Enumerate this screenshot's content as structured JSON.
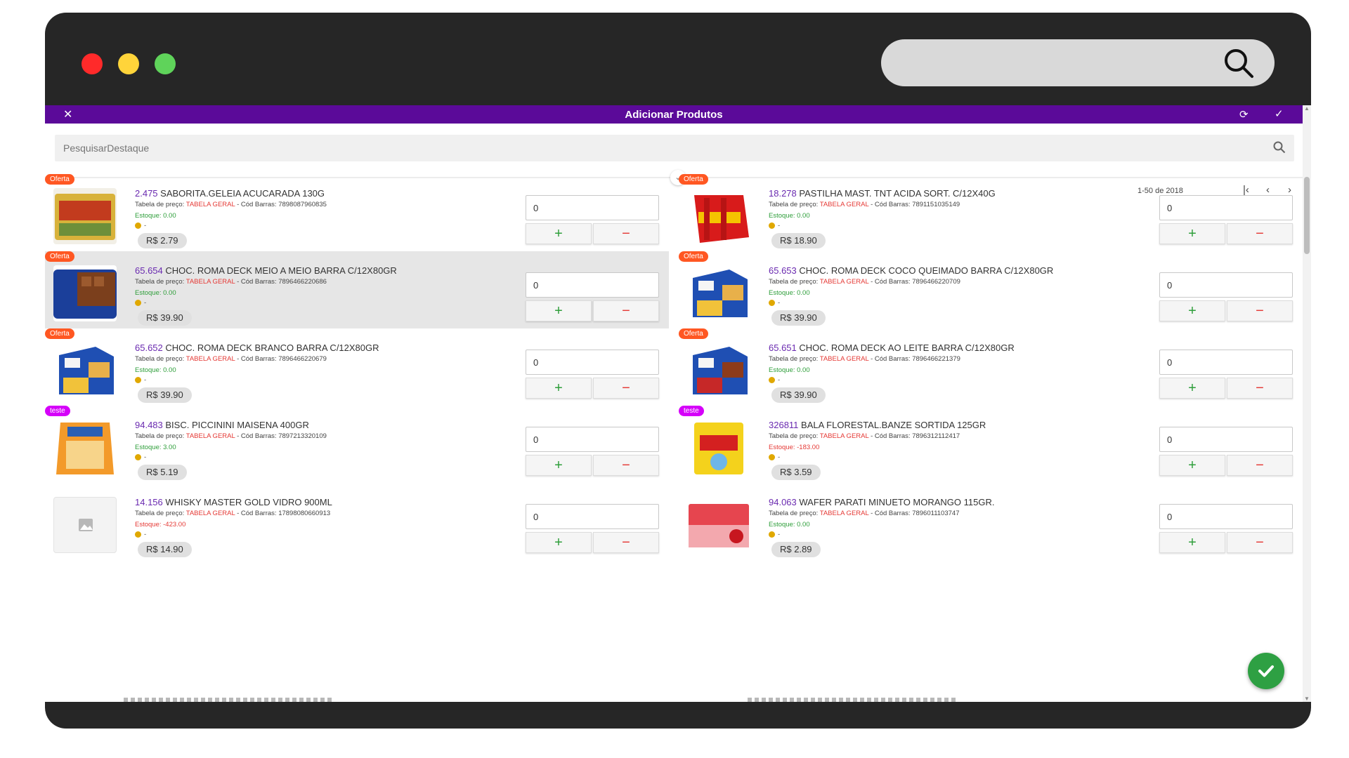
{
  "window": {
    "controls": [
      "close",
      "minimize",
      "maximize"
    ],
    "search_icon": "search-icon"
  },
  "topbar": {
    "title": "Adicionar Produtos",
    "close_glyph": "✕",
    "refresh_glyph": "⟳",
    "confirm_glyph": "✓"
  },
  "search": {
    "placeholder": "PesquisarDestaque"
  },
  "pager": {
    "range": "1-50 de 2018",
    "first": "|‹",
    "prev": "‹",
    "next": "›",
    "last": "›|"
  },
  "labels": {
    "price_table_prefix": "Tabela de preço:",
    "barcode_prefix": "- Cód Barras:",
    "coin_suffix": "-",
    "plus": "+",
    "minus": "−"
  },
  "colors": {
    "accent": "#5b0a99",
    "offer_badge": "#ff5722",
    "test_badge": "#d500f9",
    "stock_ok": "#2e9e3a",
    "stock_neg": "#e53935"
  },
  "products": [
    {
      "badge": "Oferta",
      "badge_type": "offer",
      "code": "2.475",
      "name": "SABORITA.GELEIA ACUCARADA 130G",
      "table": "TABELA GERAL",
      "barcode": "7898087960835",
      "stock": "Estoque: 0.00",
      "stock_status": "ok",
      "price": "R$ 2.79",
      "qty": "0",
      "thumb": "geleia",
      "selected": false
    },
    {
      "badge": "Oferta",
      "badge_type": "offer",
      "code": "18.278",
      "name": "PASTILHA MAST. TNT ACIDA SORT. C/12X40G",
      "table": "TABELA GERAL",
      "barcode": "7891151035149",
      "stock": "Estoque: 0.00",
      "stock_status": "ok",
      "price": "R$ 18.90",
      "qty": "0",
      "thumb": "tnt",
      "selected": false
    },
    {
      "badge": "Oferta",
      "badge_type": "offer",
      "code": "65.654",
      "name": "CHOC. ROMA DECK MEIO A MEIO BARRA C/12X80GR",
      "table": "TABELA GERAL",
      "barcode": "7896466220686",
      "stock": "Estoque: 0.00",
      "stock_status": "ok",
      "price": "R$ 39.90",
      "qty": "0",
      "thumb": "deck-meio",
      "selected": true
    },
    {
      "badge": "Oferta",
      "badge_type": "offer",
      "code": "65.653",
      "name": "CHOC. ROMA DECK COCO QUEIMADO BARRA C/12X80GR",
      "table": "TABELA GERAL",
      "barcode": "7896466220709",
      "stock": "Estoque: 0.00",
      "stock_status": "ok",
      "price": "R$ 39.90",
      "qty": "0",
      "thumb": "deck-blue",
      "selected": false
    },
    {
      "badge": "Oferta",
      "badge_type": "offer",
      "code": "65.652",
      "name": "CHOC. ROMA DECK BRANCO BARRA C/12X80GR",
      "table": "TABELA GERAL",
      "barcode": "7896466220679",
      "stock": "Estoque: 0.00",
      "stock_status": "ok",
      "price": "R$ 39.90",
      "qty": "0",
      "thumb": "deck-blue",
      "selected": false
    },
    {
      "badge": "Oferta",
      "badge_type": "offer",
      "code": "65.651",
      "name": "CHOC. ROMA DECK AO LEITE BARRA C/12X80GR",
      "table": "TABELA GERAL",
      "barcode": "7896466221379",
      "stock": "Estoque: 0.00",
      "stock_status": "ok",
      "price": "R$ 39.90",
      "qty": "0",
      "thumb": "deck-red",
      "selected": false
    },
    {
      "badge": "teste",
      "badge_type": "test",
      "code": "94.483",
      "name": "BISC. PICCININI MAISENA 400GR",
      "table": "TABELA GERAL",
      "barcode": "7897213320109",
      "stock": "Estoque: 3.00",
      "stock_status": "ok",
      "price": "R$ 5.19",
      "qty": "0",
      "thumb": "maisena",
      "selected": false
    },
    {
      "badge": "teste",
      "badge_type": "test",
      "code": "326811",
      "name": "BALA FLORESTAL.BANZE SORTIDA 125GR",
      "table": "TABELA GERAL",
      "barcode": "7896312112417",
      "stock": "Estoque: -183.00",
      "stock_status": "neg",
      "price": "R$ 3.59",
      "qty": "0",
      "thumb": "banze",
      "selected": false
    },
    {
      "badge": "",
      "badge_type": "none",
      "code": "14.156",
      "name": "WHISKY MASTER GOLD VIDRO 900ML",
      "table": "TABELA GERAL",
      "barcode": "17898080660913",
      "stock": "Estoque: -423.00",
      "stock_status": "neg",
      "price": "R$ 14.90",
      "qty": "0",
      "thumb": "placeholder",
      "selected": false
    },
    {
      "badge": "",
      "badge_type": "none",
      "code": "94.063",
      "name": "WAFER PARATI MINUETO MORANGO 115GR.",
      "table": "TABELA GERAL",
      "barcode": "7896011103747",
      "stock": "Estoque: 0.00",
      "stock_status": "ok",
      "price": "R$ 2.89",
      "qty": "0",
      "thumb": "minueto",
      "selected": false
    }
  ]
}
